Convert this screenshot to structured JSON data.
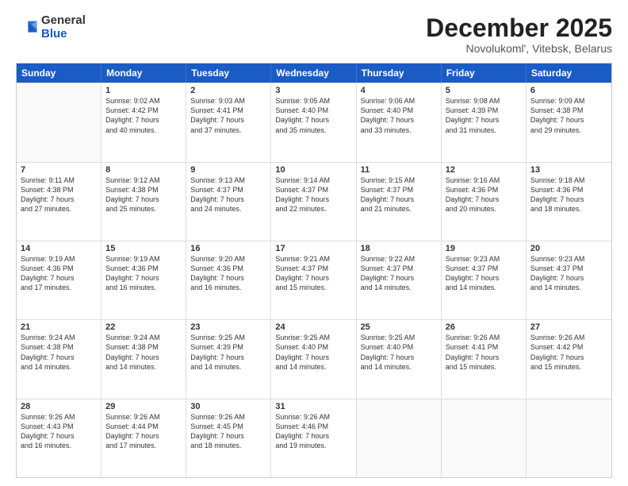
{
  "logo": {
    "general": "General",
    "blue": "Blue"
  },
  "title": "December 2025",
  "subtitle": "Novolukoml', Vitebsk, Belarus",
  "header_days": [
    "Sunday",
    "Monday",
    "Tuesday",
    "Wednesday",
    "Thursday",
    "Friday",
    "Saturday"
  ],
  "weeks": [
    [
      {
        "day": "",
        "info": ""
      },
      {
        "day": "1",
        "info": "Sunrise: 9:02 AM\nSunset: 4:42 PM\nDaylight: 7 hours\nand 40 minutes."
      },
      {
        "day": "2",
        "info": "Sunrise: 9:03 AM\nSunset: 4:41 PM\nDaylight: 7 hours\nand 37 minutes."
      },
      {
        "day": "3",
        "info": "Sunrise: 9:05 AM\nSunset: 4:40 PM\nDaylight: 7 hours\nand 35 minutes."
      },
      {
        "day": "4",
        "info": "Sunrise: 9:06 AM\nSunset: 4:40 PM\nDaylight: 7 hours\nand 33 minutes."
      },
      {
        "day": "5",
        "info": "Sunrise: 9:08 AM\nSunset: 4:39 PM\nDaylight: 7 hours\nand 31 minutes."
      },
      {
        "day": "6",
        "info": "Sunrise: 9:09 AM\nSunset: 4:38 PM\nDaylight: 7 hours\nand 29 minutes."
      }
    ],
    [
      {
        "day": "7",
        "info": "Sunrise: 9:11 AM\nSunset: 4:38 PM\nDaylight: 7 hours\nand 27 minutes."
      },
      {
        "day": "8",
        "info": "Sunrise: 9:12 AM\nSunset: 4:38 PM\nDaylight: 7 hours\nand 25 minutes."
      },
      {
        "day": "9",
        "info": "Sunrise: 9:13 AM\nSunset: 4:37 PM\nDaylight: 7 hours\nand 24 minutes."
      },
      {
        "day": "10",
        "info": "Sunrise: 9:14 AM\nSunset: 4:37 PM\nDaylight: 7 hours\nand 22 minutes."
      },
      {
        "day": "11",
        "info": "Sunrise: 9:15 AM\nSunset: 4:37 PM\nDaylight: 7 hours\nand 21 minutes."
      },
      {
        "day": "12",
        "info": "Sunrise: 9:16 AM\nSunset: 4:36 PM\nDaylight: 7 hours\nand 20 minutes."
      },
      {
        "day": "13",
        "info": "Sunrise: 9:18 AM\nSunset: 4:36 PM\nDaylight: 7 hours\nand 18 minutes."
      }
    ],
    [
      {
        "day": "14",
        "info": "Sunrise: 9:19 AM\nSunset: 4:36 PM\nDaylight: 7 hours\nand 17 minutes."
      },
      {
        "day": "15",
        "info": "Sunrise: 9:19 AM\nSunset: 4:36 PM\nDaylight: 7 hours\nand 16 minutes."
      },
      {
        "day": "16",
        "info": "Sunrise: 9:20 AM\nSunset: 4:36 PM\nDaylight: 7 hours\nand 16 minutes."
      },
      {
        "day": "17",
        "info": "Sunrise: 9:21 AM\nSunset: 4:37 PM\nDaylight: 7 hours\nand 15 minutes."
      },
      {
        "day": "18",
        "info": "Sunrise: 9:22 AM\nSunset: 4:37 PM\nDaylight: 7 hours\nand 14 minutes."
      },
      {
        "day": "19",
        "info": "Sunrise: 9:23 AM\nSunset: 4:37 PM\nDaylight: 7 hours\nand 14 minutes."
      },
      {
        "day": "20",
        "info": "Sunrise: 9:23 AM\nSunset: 4:37 PM\nDaylight: 7 hours\nand 14 minutes."
      }
    ],
    [
      {
        "day": "21",
        "info": "Sunrise: 9:24 AM\nSunset: 4:38 PM\nDaylight: 7 hours\nand 14 minutes."
      },
      {
        "day": "22",
        "info": "Sunrise: 9:24 AM\nSunset: 4:38 PM\nDaylight: 7 hours\nand 14 minutes."
      },
      {
        "day": "23",
        "info": "Sunrise: 9:25 AM\nSunset: 4:39 PM\nDaylight: 7 hours\nand 14 minutes."
      },
      {
        "day": "24",
        "info": "Sunrise: 9:25 AM\nSunset: 4:40 PM\nDaylight: 7 hours\nand 14 minutes."
      },
      {
        "day": "25",
        "info": "Sunrise: 9:25 AM\nSunset: 4:40 PM\nDaylight: 7 hours\nand 14 minutes."
      },
      {
        "day": "26",
        "info": "Sunrise: 9:26 AM\nSunset: 4:41 PM\nDaylight: 7 hours\nand 15 minutes."
      },
      {
        "day": "27",
        "info": "Sunrise: 9:26 AM\nSunset: 4:42 PM\nDaylight: 7 hours\nand 15 minutes."
      }
    ],
    [
      {
        "day": "28",
        "info": "Sunrise: 9:26 AM\nSunset: 4:43 PM\nDaylight: 7 hours\nand 16 minutes."
      },
      {
        "day": "29",
        "info": "Sunrise: 9:26 AM\nSunset: 4:44 PM\nDaylight: 7 hours\nand 17 minutes."
      },
      {
        "day": "30",
        "info": "Sunrise: 9:26 AM\nSunset: 4:45 PM\nDaylight: 7 hours\nand 18 minutes."
      },
      {
        "day": "31",
        "info": "Sunrise: 9:26 AM\nSunset: 4:46 PM\nDaylight: 7 hours\nand 19 minutes."
      },
      {
        "day": "",
        "info": ""
      },
      {
        "day": "",
        "info": ""
      },
      {
        "day": "",
        "info": ""
      }
    ]
  ]
}
